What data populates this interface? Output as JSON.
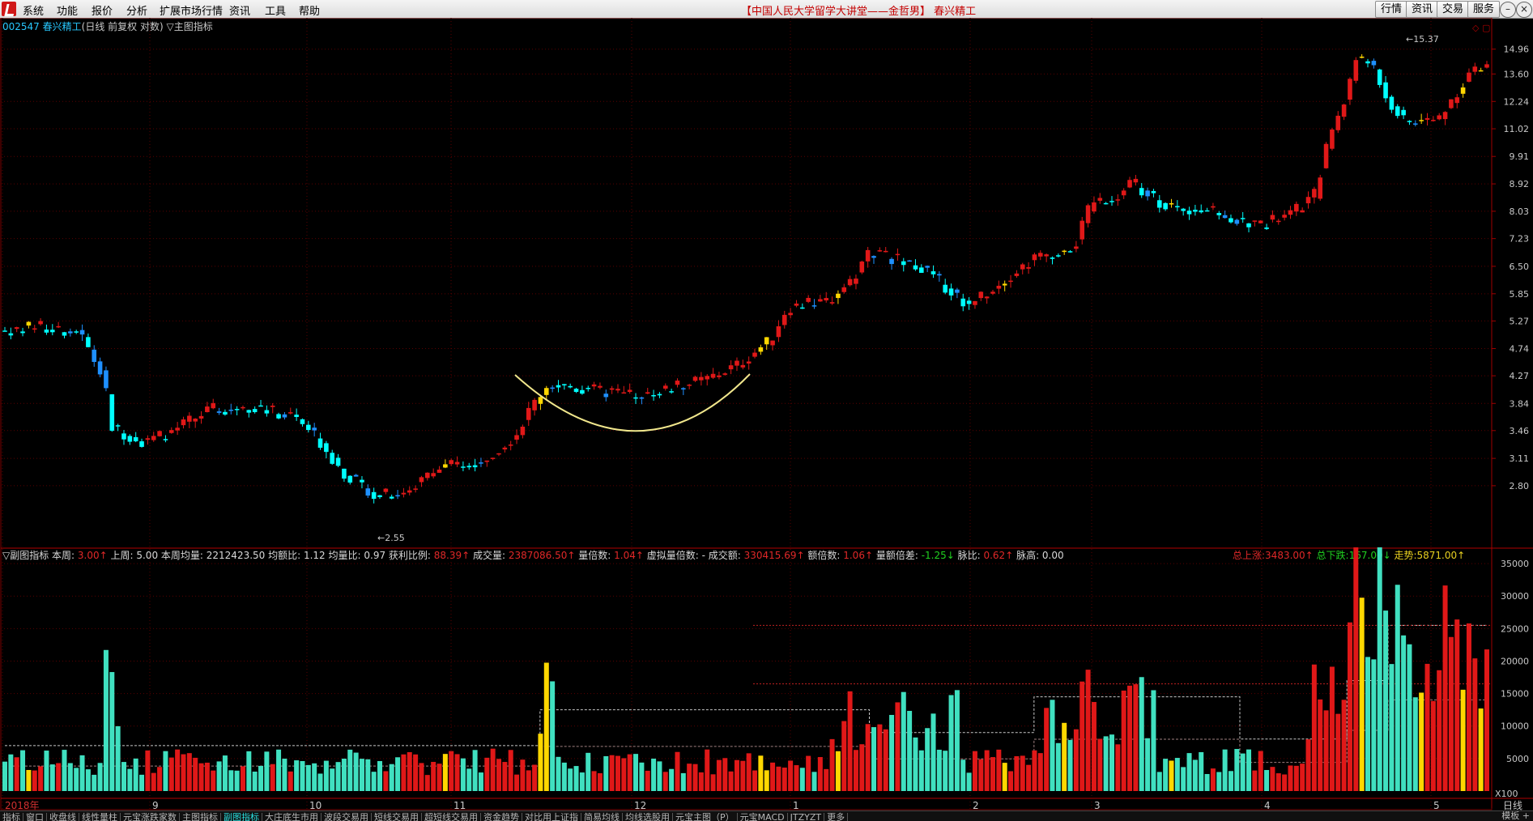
{
  "menu": [
    "系统",
    "功能",
    "报价",
    "分析",
    "扩展市场行情",
    "资讯",
    "工具",
    "帮助"
  ],
  "title_bracketed": "【中国人民大学留学大讲堂——金哲男】",
  "title_stock": "春兴精工",
  "toolbar_buttons": [
    "行情",
    "资讯",
    "交易",
    "服务"
  ],
  "main_info": {
    "code": "002547",
    "name": "春兴精工",
    "mode": "(日线 前复权 对数)",
    "indicator": "▽主图指标"
  },
  "price_axis": [
    "14.96",
    "13.60",
    "12.24",
    "11.02",
    "9.91",
    "8.92",
    "8.03",
    "7.23",
    "6.50",
    "5.85",
    "5.27",
    "4.74",
    "4.27",
    "3.84",
    "3.46",
    "3.11",
    "2.80"
  ],
  "high_label": "15.37",
  "low_label": "2.55",
  "sub_info": [
    {
      "k": "▽副图指标",
      "v": "",
      "c": "#d8d8d8"
    },
    {
      "k": "本周:",
      "v": "3.00↑",
      "c": "#e02828"
    },
    {
      "k": "上周:",
      "v": "5.00",
      "c": "#d8d8d8"
    },
    {
      "k": "本周均量:",
      "v": "2212423.50",
      "c": "#d8d8d8"
    },
    {
      "k": "均额比:",
      "v": "1.12",
      "c": "#d8d8d8"
    },
    {
      "k": "均量比:",
      "v": "0.97",
      "c": "#d8d8d8"
    },
    {
      "k": "获利比例:",
      "v": "88.39↑",
      "c": "#e02828"
    },
    {
      "k": "成交量:",
      "v": "2387086.50↑",
      "c": "#e02828"
    },
    {
      "k": "量倍数:",
      "v": "1.04↑",
      "c": "#e02828"
    },
    {
      "k": "虚拟量倍数:",
      "v": "-",
      "c": "#d8d8d8"
    },
    {
      "k": "成交额:",
      "v": "330415.69↑",
      "c": "#e02828"
    },
    {
      "k": "额倍数:",
      "v": "1.06↑",
      "c": "#e02828"
    },
    {
      "k": "量额倍差:",
      "v": "-1.25↓",
      "c": "#20d020"
    },
    {
      "k": "脉比:",
      "v": "0.62↑",
      "c": "#e02828"
    },
    {
      "k": "脉高:",
      "v": "0.00",
      "c": "#d8d8d8"
    }
  ],
  "sub_right": [
    {
      "k": "总上涨:",
      "v": "3483.00↑",
      "c": "#e02828"
    },
    {
      "k": "总下跌:",
      "v": "167.00↓",
      "c": "#20d020"
    },
    {
      "k": "走势:",
      "v": "5871.00↑",
      "c": "#e8d020"
    }
  ],
  "volume_axis": [
    "35000",
    "30000",
    "25000",
    "20000",
    "15000",
    "10000",
    "5000"
  ],
  "volume_unit": "X100",
  "time_axis": [
    "2018年",
    "9",
    "10",
    "11",
    "12",
    "1",
    "2",
    "3",
    "4",
    "5"
  ],
  "period_label": "日线",
  "tabs": [
    "指标",
    "窗口",
    "收盘线",
    "线性量柱",
    "元宝涨跌家数",
    "主图指标",
    "副图指标",
    "大庄底生市用",
    "波段交易用",
    "短线交易用",
    "超短线交易用",
    "资金趋势",
    "对比用上证指",
    "简易均线",
    "均线选股用",
    "元宝主图（P）",
    "元宝MACD",
    "JTZYZT",
    "更多"
  ],
  "active_tab": "副图指标",
  "tab_right": "模板",
  "colors": {
    "up": "#e01818",
    "down_fill": "#00ffff",
    "limit": "#ffd700",
    "cup": "#f0e68c",
    "grid": "#5a0000"
  },
  "chart_data": {
    "type": "candlestick",
    "price_range": [
      2.55,
      15.37
    ],
    "volume_range": [
      0,
      38000
    ],
    "candle_count": 250
  }
}
